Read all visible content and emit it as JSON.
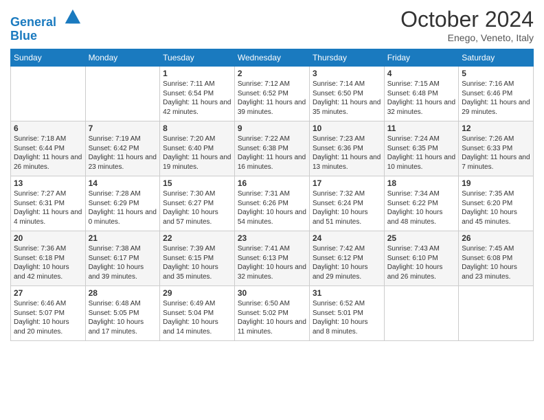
{
  "header": {
    "logo_line1": "General",
    "logo_line2": "Blue",
    "month": "October 2024",
    "location": "Enego, Veneto, Italy"
  },
  "days_of_week": [
    "Sunday",
    "Monday",
    "Tuesday",
    "Wednesday",
    "Thursday",
    "Friday",
    "Saturday"
  ],
  "weeks": [
    [
      {
        "day": "",
        "info": ""
      },
      {
        "day": "",
        "info": ""
      },
      {
        "day": "1",
        "info": "Sunrise: 7:11 AM\nSunset: 6:54 PM\nDaylight: 11 hours and 42 minutes."
      },
      {
        "day": "2",
        "info": "Sunrise: 7:12 AM\nSunset: 6:52 PM\nDaylight: 11 hours and 39 minutes."
      },
      {
        "day": "3",
        "info": "Sunrise: 7:14 AM\nSunset: 6:50 PM\nDaylight: 11 hours and 35 minutes."
      },
      {
        "day": "4",
        "info": "Sunrise: 7:15 AM\nSunset: 6:48 PM\nDaylight: 11 hours and 32 minutes."
      },
      {
        "day": "5",
        "info": "Sunrise: 7:16 AM\nSunset: 6:46 PM\nDaylight: 11 hours and 29 minutes."
      }
    ],
    [
      {
        "day": "6",
        "info": "Sunrise: 7:18 AM\nSunset: 6:44 PM\nDaylight: 11 hours and 26 minutes."
      },
      {
        "day": "7",
        "info": "Sunrise: 7:19 AM\nSunset: 6:42 PM\nDaylight: 11 hours and 23 minutes."
      },
      {
        "day": "8",
        "info": "Sunrise: 7:20 AM\nSunset: 6:40 PM\nDaylight: 11 hours and 19 minutes."
      },
      {
        "day": "9",
        "info": "Sunrise: 7:22 AM\nSunset: 6:38 PM\nDaylight: 11 hours and 16 minutes."
      },
      {
        "day": "10",
        "info": "Sunrise: 7:23 AM\nSunset: 6:36 PM\nDaylight: 11 hours and 13 minutes."
      },
      {
        "day": "11",
        "info": "Sunrise: 7:24 AM\nSunset: 6:35 PM\nDaylight: 11 hours and 10 minutes."
      },
      {
        "day": "12",
        "info": "Sunrise: 7:26 AM\nSunset: 6:33 PM\nDaylight: 11 hours and 7 minutes."
      }
    ],
    [
      {
        "day": "13",
        "info": "Sunrise: 7:27 AM\nSunset: 6:31 PM\nDaylight: 11 hours and 4 minutes."
      },
      {
        "day": "14",
        "info": "Sunrise: 7:28 AM\nSunset: 6:29 PM\nDaylight: 11 hours and 0 minutes."
      },
      {
        "day": "15",
        "info": "Sunrise: 7:30 AM\nSunset: 6:27 PM\nDaylight: 10 hours and 57 minutes."
      },
      {
        "day": "16",
        "info": "Sunrise: 7:31 AM\nSunset: 6:26 PM\nDaylight: 10 hours and 54 minutes."
      },
      {
        "day": "17",
        "info": "Sunrise: 7:32 AM\nSunset: 6:24 PM\nDaylight: 10 hours and 51 minutes."
      },
      {
        "day": "18",
        "info": "Sunrise: 7:34 AM\nSunset: 6:22 PM\nDaylight: 10 hours and 48 minutes."
      },
      {
        "day": "19",
        "info": "Sunrise: 7:35 AM\nSunset: 6:20 PM\nDaylight: 10 hours and 45 minutes."
      }
    ],
    [
      {
        "day": "20",
        "info": "Sunrise: 7:36 AM\nSunset: 6:18 PM\nDaylight: 10 hours and 42 minutes."
      },
      {
        "day": "21",
        "info": "Sunrise: 7:38 AM\nSunset: 6:17 PM\nDaylight: 10 hours and 39 minutes."
      },
      {
        "day": "22",
        "info": "Sunrise: 7:39 AM\nSunset: 6:15 PM\nDaylight: 10 hours and 35 minutes."
      },
      {
        "day": "23",
        "info": "Sunrise: 7:41 AM\nSunset: 6:13 PM\nDaylight: 10 hours and 32 minutes."
      },
      {
        "day": "24",
        "info": "Sunrise: 7:42 AM\nSunset: 6:12 PM\nDaylight: 10 hours and 29 minutes."
      },
      {
        "day": "25",
        "info": "Sunrise: 7:43 AM\nSunset: 6:10 PM\nDaylight: 10 hours and 26 minutes."
      },
      {
        "day": "26",
        "info": "Sunrise: 7:45 AM\nSunset: 6:08 PM\nDaylight: 10 hours and 23 minutes."
      }
    ],
    [
      {
        "day": "27",
        "info": "Sunrise: 6:46 AM\nSunset: 5:07 PM\nDaylight: 10 hours and 20 minutes."
      },
      {
        "day": "28",
        "info": "Sunrise: 6:48 AM\nSunset: 5:05 PM\nDaylight: 10 hours and 17 minutes."
      },
      {
        "day": "29",
        "info": "Sunrise: 6:49 AM\nSunset: 5:04 PM\nDaylight: 10 hours and 14 minutes."
      },
      {
        "day": "30",
        "info": "Sunrise: 6:50 AM\nSunset: 5:02 PM\nDaylight: 10 hours and 11 minutes."
      },
      {
        "day": "31",
        "info": "Sunrise: 6:52 AM\nSunset: 5:01 PM\nDaylight: 10 hours and 8 minutes."
      },
      {
        "day": "",
        "info": ""
      },
      {
        "day": "",
        "info": ""
      }
    ]
  ]
}
